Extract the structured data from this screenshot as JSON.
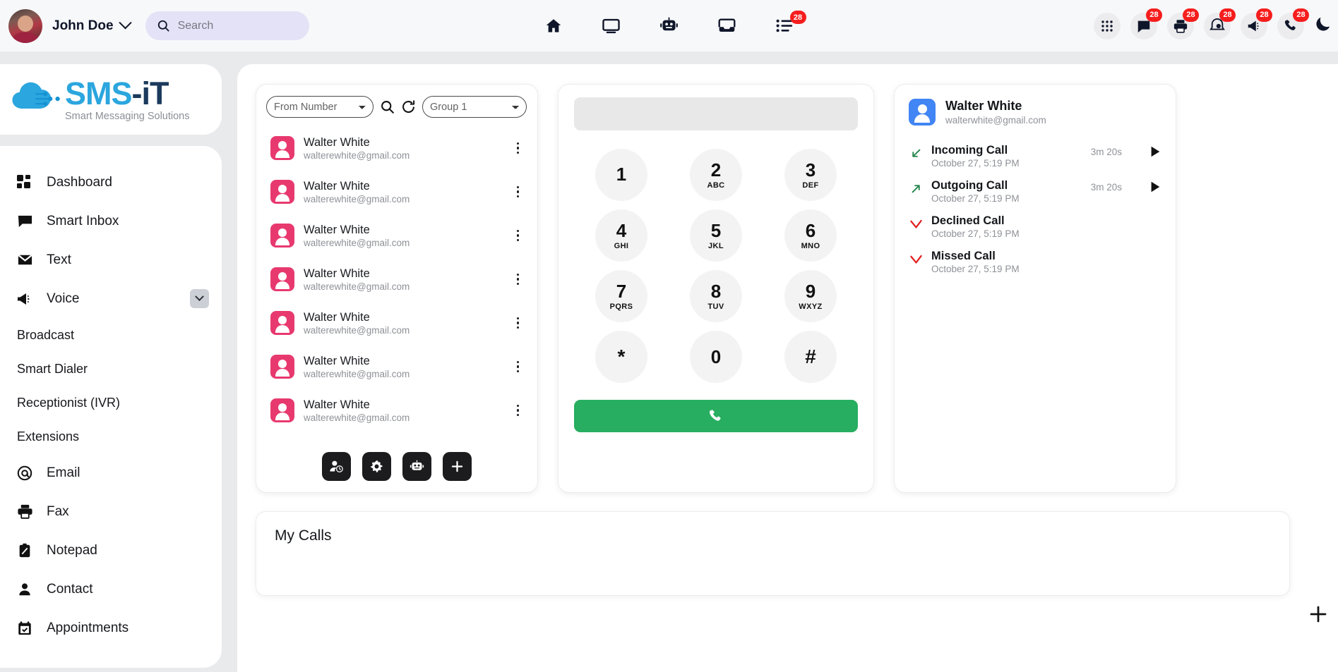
{
  "topbar": {
    "username": "John Doe",
    "search_placeholder": "Search",
    "center_icons": [
      {
        "name": "home-icon"
      },
      {
        "name": "monitor-icon"
      },
      {
        "name": "robot-icon"
      },
      {
        "name": "inbox-tray-icon"
      },
      {
        "name": "task-list-icon",
        "badge": "28"
      }
    ],
    "right_icons": [
      {
        "name": "apps-grid-icon",
        "badge": null
      },
      {
        "name": "chat-icon",
        "badge": "28"
      },
      {
        "name": "fax-icon",
        "badge": "28"
      },
      {
        "name": "notification-icon",
        "badge": "28"
      },
      {
        "name": "megaphone-icon",
        "badge": "28"
      },
      {
        "name": "phone-icon",
        "badge": "28"
      },
      {
        "name": "dark-mode-moon-icon",
        "badge": null
      }
    ]
  },
  "sidebar": {
    "logo": {
      "main_sms": "SMS",
      "main_it": "-iT",
      "tagline": "Smart Messaging Solutions"
    },
    "items": [
      {
        "label": "Dashboard",
        "icon": "dashboard-grid-icon",
        "type": "item"
      },
      {
        "label": "Smart Inbox",
        "icon": "chat-bubble-icon",
        "type": "item"
      },
      {
        "label": "Text",
        "icon": "envelope-icon",
        "type": "item"
      },
      {
        "label": "Voice",
        "icon": "megaphone-icon",
        "type": "item",
        "expandable": true
      },
      {
        "label": "Broadcast",
        "type": "sub"
      },
      {
        "label": "Smart Dialer",
        "type": "sub"
      },
      {
        "label": "Receptionist (IVR)",
        "type": "sub"
      },
      {
        "label": "Extensions",
        "type": "sub"
      },
      {
        "label": "Email",
        "icon": "at-sign-icon",
        "type": "item"
      },
      {
        "label": "Fax",
        "icon": "printer-icon",
        "type": "item"
      },
      {
        "label": "Notepad",
        "icon": "clipboard-icon",
        "type": "item"
      },
      {
        "label": "Contact",
        "icon": "person-icon",
        "type": "item"
      },
      {
        "label": "Appointments",
        "icon": "calendar-check-icon",
        "type": "item"
      }
    ]
  },
  "contacts_panel": {
    "from_number_label": "From Number",
    "group_label": "Group 1",
    "rows": [
      {
        "name": "Walter White",
        "email": "walterewhite@gmail.com"
      },
      {
        "name": "Walter White",
        "email": "walterewhite@gmail.com"
      },
      {
        "name": "Walter White",
        "email": "walterewhite@gmail.com"
      },
      {
        "name": "Walter White",
        "email": "walterewhite@gmail.com"
      },
      {
        "name": "Walter White",
        "email": "walterewhite@gmail.com"
      },
      {
        "name": "Walter White",
        "email": "walterewhite@gmail.com"
      },
      {
        "name": "Walter White",
        "email": "walterewhite@gmail.com"
      }
    ],
    "actions": [
      {
        "name": "contact-history-button"
      },
      {
        "name": "settings-gear-button"
      },
      {
        "name": "robot-assistant-button"
      },
      {
        "name": "add-contact-button"
      }
    ]
  },
  "dialer": {
    "display_value": "",
    "keys": [
      {
        "num": "1",
        "letters": ""
      },
      {
        "num": "2",
        "letters": "ABC"
      },
      {
        "num": "3",
        "letters": "DEF"
      },
      {
        "num": "4",
        "letters": "GHI"
      },
      {
        "num": "5",
        "letters": "JKL"
      },
      {
        "num": "6",
        "letters": "MNO"
      },
      {
        "num": "7",
        "letters": "PQRS"
      },
      {
        "num": "8",
        "letters": "TUV"
      },
      {
        "num": "9",
        "letters": "WXYZ"
      },
      {
        "num": "*",
        "letters": ""
      },
      {
        "num": "0",
        "letters": ""
      },
      {
        "num": "#",
        "letters": ""
      }
    ],
    "call_button_color": "#27ae60"
  },
  "call_history": {
    "contact_name": "Walter White",
    "contact_email": "walterwhite@gmail.com",
    "entries": [
      {
        "type": "Incoming Call",
        "date": "October 27, 5:19 PM",
        "duration": "3m 20s",
        "arrow": "incoming-arrow-icon",
        "color": "#1e8449",
        "has_play": true
      },
      {
        "type": "Outgoing Call",
        "date": "October 27, 5:19 PM",
        "duration": "3m 20s",
        "arrow": "outgoing-arrow-icon",
        "color": "#1e8449",
        "has_play": true
      },
      {
        "type": "Declined Call",
        "date": "October 27, 5:19 PM",
        "duration": "",
        "arrow": "declined-arrow-icon",
        "color": "#e02020",
        "has_play": false
      },
      {
        "type": "Missed Call",
        "date": "October 27, 5:19 PM",
        "duration": "",
        "arrow": "missed-arrow-icon",
        "color": "#e02020",
        "has_play": false
      }
    ]
  },
  "my_calls": {
    "title": "My Calls"
  },
  "fab": {
    "name": "add-floating-button"
  }
}
